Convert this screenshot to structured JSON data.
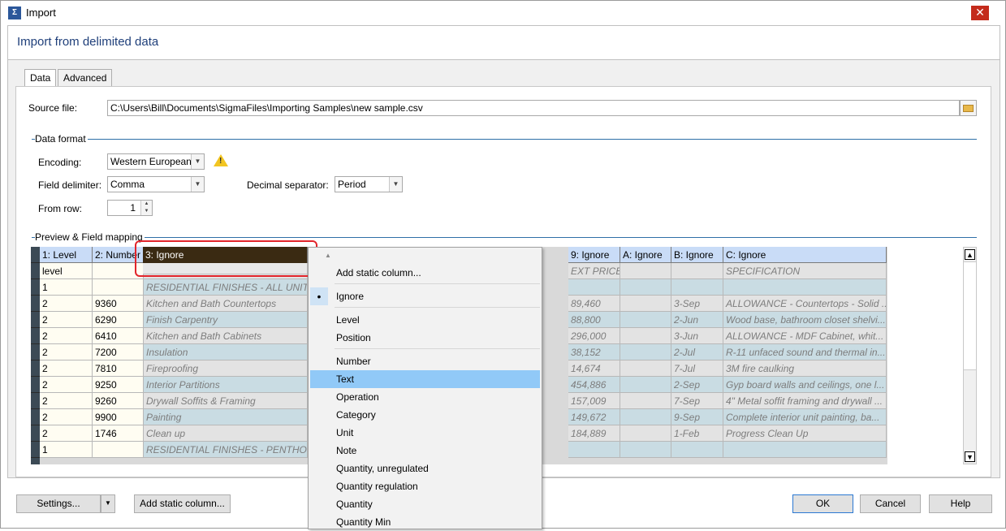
{
  "window": {
    "title": "Import",
    "app_icon": "sigma-app-icon",
    "close": "✕"
  },
  "header": {
    "title": "Import from delimited data"
  },
  "tabs": [
    "Data",
    "Advanced"
  ],
  "source": {
    "label": "Source file:",
    "value": "C:\\Users\\Bill\\Documents\\SigmaFiles\\Importing Samples\\new sample.csv"
  },
  "data_format": {
    "group_label": "Data format",
    "encoding_label": "Encoding:",
    "encoding_value": "Western European",
    "delimiter_label": "Field delimiter:",
    "delimiter_value": "Comma",
    "decimal_label": "Decimal separator:",
    "decimal_value": "Period",
    "from_row_label": "From row:",
    "from_row_value": "1"
  },
  "preview": {
    "group_label": "Preview & Field mapping",
    "headers": [
      "1: Level",
      "2: Number",
      "3: Ignore",
      "",
      "",
      "",
      "",
      "",
      "9: Ignore",
      "A: Ignore",
      "B: Ignore",
      "C: Ignore"
    ],
    "rows": [
      [
        "level",
        "",
        "",
        "EXT PRICE",
        "",
        "",
        "SPECIFICATION"
      ],
      [
        "1",
        "",
        "RESIDENTIAL FINISHES - ALL UNITS",
        "",
        "",
        "",
        ""
      ],
      [
        "2",
        "9360",
        "Kitchen and Bath Countertops",
        "89,460",
        "",
        "3-Sep",
        "ALLOWANCE - Countertops - Solid ..."
      ],
      [
        "2",
        "6290",
        "Finish Carpentry",
        "88,800",
        "",
        "2-Jun",
        "Wood base, bathroom closet shelvi..."
      ],
      [
        "2",
        "6410",
        "Kitchen and Bath Cabinets",
        "296,000",
        "",
        "3-Jun",
        "ALLOWANCE - MDF Cabinet, whit..."
      ],
      [
        "2",
        "7200",
        "Insulation",
        "38,152",
        "",
        "2-Jul",
        "R-11 unfaced sound and thermal in..."
      ],
      [
        "2",
        "7810",
        "Fireproofing",
        "14,674",
        "",
        "7-Jul",
        "3M fire caulking"
      ],
      [
        "2",
        "9250",
        "Interior Partitions",
        "454,886",
        "",
        "2-Sep",
        "Gyp board walls and ceilings, one l..."
      ],
      [
        "2",
        "9260",
        "Drywall Soffits & Framing",
        "157,009",
        "",
        "7-Sep",
        "4\" Metal soffit framing and drywall ..."
      ],
      [
        "2",
        "9900",
        "Painting",
        "149,672",
        "",
        "9-Sep",
        "Complete interior unit painting, ba..."
      ],
      [
        "2",
        "1746",
        "Clean up",
        "184,889",
        "",
        "1-Feb",
        "Progress Clean Up"
      ],
      [
        "1",
        "",
        "RESIDENTIAL FINISHES - PENTHOU...",
        "",
        "",
        "",
        ""
      ]
    ]
  },
  "context_menu": {
    "items": [
      "Add static column...",
      "Ignore",
      "Level",
      "Position",
      "Number",
      "Text",
      "Operation",
      "Category",
      "Unit",
      "Note",
      "Quantity, unregulated",
      "Quantity regulation",
      "Quantity",
      "Quantity Min"
    ],
    "checked": "Ignore",
    "highlighted": "Text"
  },
  "footer": {
    "settings": "Settings...",
    "add_static": "Add static column...",
    "ok": "OK",
    "cancel": "Cancel",
    "help": "Help"
  },
  "colors": {
    "header_title": "#1f3f7a",
    "grid_header": "#c9dcf7",
    "menu_highlight": "#91c9f7",
    "close": "#c42b1c"
  }
}
